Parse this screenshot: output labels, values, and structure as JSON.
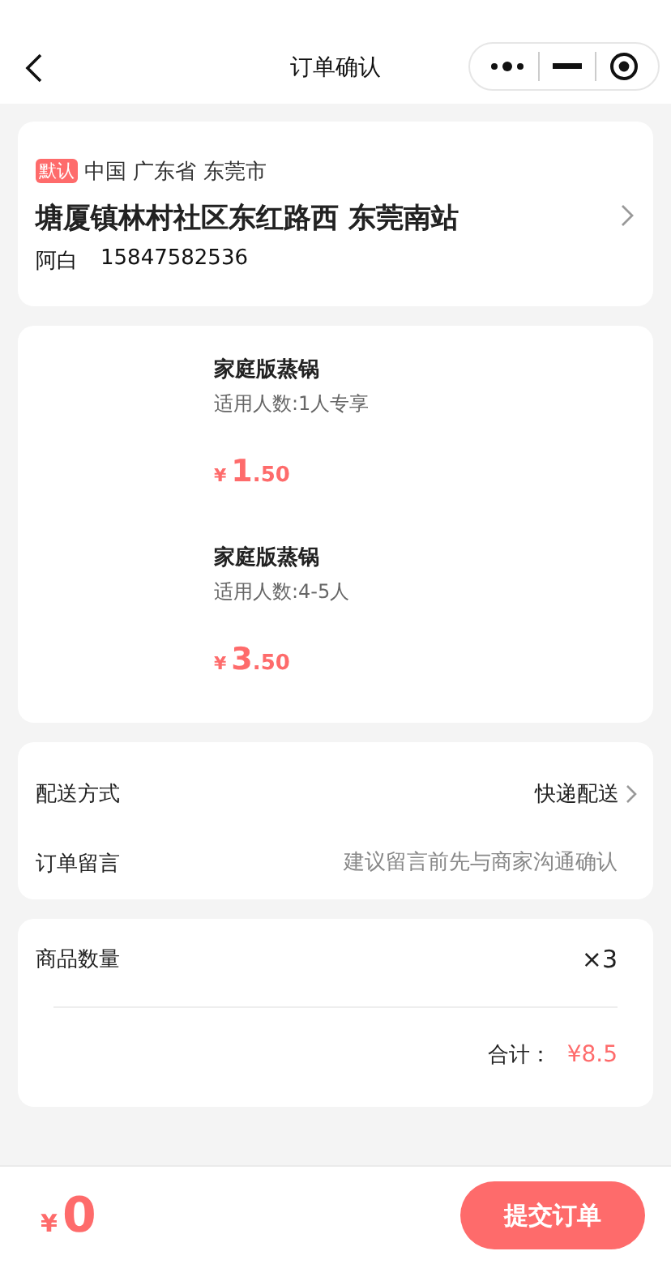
{
  "nav": {
    "title": "订单确认"
  },
  "address": {
    "tag": "默认",
    "region": "中国 广东省 东莞市",
    "detail": "塘厦镇林村社区东红路西 东莞南站",
    "name": "阿白",
    "phone": "15847582536"
  },
  "products": [
    {
      "name": "家庭版蒸锅",
      "spec": "适用人数:1人专享",
      "price": {
        "currency": "¥",
        "integer": "1",
        "decimal": ".50"
      }
    },
    {
      "name": "家庭版蒸锅",
      "spec": "适用人数:4-5人",
      "price": {
        "currency": "¥",
        "integer": "3",
        "decimal": ".50"
      }
    }
  ],
  "options": [
    {
      "kind": "select",
      "label": "配送方式",
      "value": "快递配送"
    },
    {
      "kind": "input",
      "label": "订单留言",
      "placeholder": "建议留言前先与商家沟通确认"
    }
  ],
  "summary": {
    "quantity_label": "商品数量",
    "quantity": "×3",
    "total_label": "合计：",
    "total": "¥8.5"
  },
  "footer": {
    "currency": "¥",
    "amount": "0",
    "submit": "提交订单"
  }
}
